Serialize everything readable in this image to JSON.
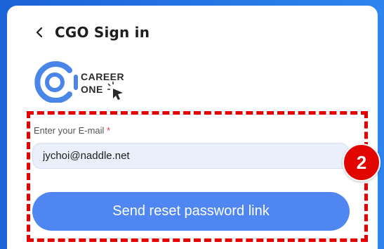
{
  "header": {
    "back_icon": "chevron-left-icon",
    "title": "CGO Sign in"
  },
  "logo": {
    "line1": "CAREER",
    "line2": "ONE",
    "icon": "career-one-logo-icon"
  },
  "form": {
    "email_label": "Enter your E-mail",
    "required_mark": "*",
    "email_value": "jychoi@naddle.net",
    "submit_label": "Send reset password link"
  },
  "annotation": {
    "step_number": "2",
    "color": "#e60000"
  },
  "colors": {
    "brand_blue": "#2f84f0",
    "button_blue": "#4f86f2",
    "input_bg": "#eaf0fb",
    "annotation_red": "#e60000"
  }
}
